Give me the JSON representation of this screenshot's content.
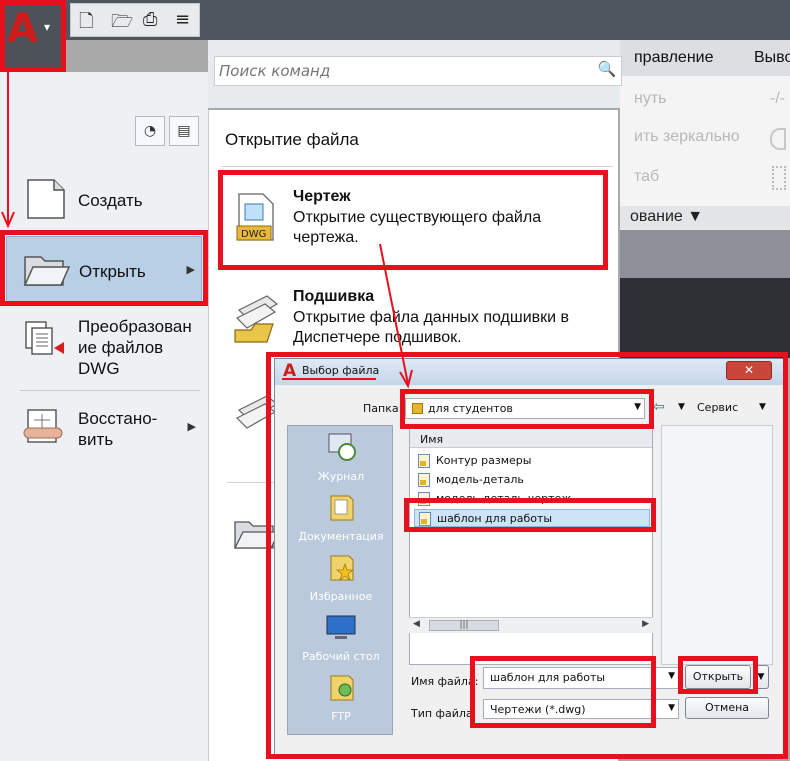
{
  "app": {
    "logo_letter": "A",
    "menu_caret": "▾",
    "quick_access": [
      "new-file-icon",
      "open-folder-icon",
      "save-icon",
      "customize-icon"
    ],
    "accent_color": "#e8101c"
  },
  "ribbon": {
    "tab_1": "правление",
    "tab_2": "Выво",
    "panel_item_1": "нуть",
    "panel_item_2": "ить зеркально",
    "panel_item_3": "таб",
    "panel_item_4": "-/-",
    "panel_label": "ование ▼"
  },
  "search": {
    "placeholder": "Поиск команд",
    "icon": "magnifier-icon"
  },
  "menu": {
    "items": [
      {
        "label": "Создать",
        "icon": "new-drawing-icon",
        "has_submenu": false
      },
      {
        "label": "Открыть",
        "icon": "open-folder-icon",
        "has_submenu": true
      },
      {
        "label": "Преобразован\nие файлов\nDWG",
        "icon": "convert-dwg-icon",
        "has_submenu": false
      },
      {
        "label": "Восстано-\nвить",
        "icon": "recover-icon",
        "has_submenu": true
      }
    ]
  },
  "submenu": {
    "title": "Открытие файла",
    "items": [
      {
        "title": "Чертеж",
        "desc": "Открытие существующего файла\nчертежа.",
        "icon_text": "DWG"
      },
      {
        "title": "Подшивка",
        "desc": "Открытие файла данных подшивки в\nДиспетчере подшивок."
      }
    ]
  },
  "dialog": {
    "title": "Выбор файла",
    "folder_label": "Папка:",
    "folder_value": "для студентов",
    "tools_label": "Сервис",
    "places": [
      "Журнал",
      "Документация",
      "Избранное",
      "Рабочий стол",
      "FTP"
    ],
    "list_header": "Имя",
    "files": [
      "Контур размеры",
      "модель-деталь",
      "модель-деталь-чертеж",
      "шаблон для работы"
    ],
    "selected_file": "шаблон для работы",
    "filename_label": "Имя файла:",
    "filename_value": "шаблон для работы",
    "filetype_label": "Тип файла:",
    "filetype_value": "Чертежи (*.dwg)",
    "open_button": "Открыть",
    "cancel_button": "Отмена"
  }
}
